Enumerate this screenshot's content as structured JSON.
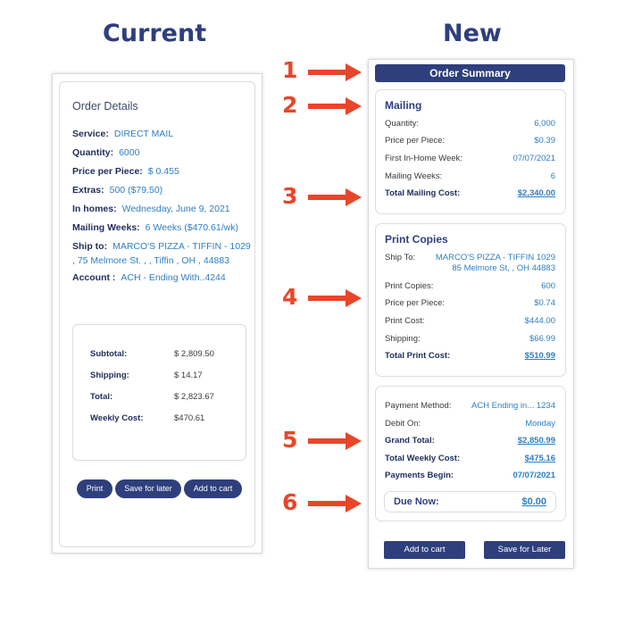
{
  "headings": {
    "current": "Current",
    "new": "New"
  },
  "current": {
    "title": "Order Details",
    "fields": [
      {
        "label": "Service:",
        "value": "DIRECT MAIL"
      },
      {
        "label": "Quantity:",
        "value": "6000"
      },
      {
        "label": "Price per Piece:",
        "value": "$ 0.455"
      },
      {
        "label": "Extras:",
        "value": "500 ($79.50)"
      },
      {
        "label": "In homes:",
        "value": "Wednesday, June 9, 2021"
      },
      {
        "label": "Mailing Weeks:",
        "value": "6 Weeks ($470.61/wk)"
      },
      {
        "label": "Ship to:",
        "value": "MARCO'S PIZZA - TIFFIN - 1029 , 75 Melmore St. , , Tiffin , OH , 44883"
      },
      {
        "label": "Account :",
        "value": "ACH - Ending With..4244"
      }
    ],
    "totals": [
      {
        "label": "Subtotal:",
        "value": "$ 2,809.50"
      },
      {
        "label": "Shipping:",
        "value": "$ 14.17"
      },
      {
        "label": "Total:",
        "value": "$ 2,823.67"
      },
      {
        "label": "Weekly Cost:",
        "value": "$470.61"
      }
    ],
    "buttons": {
      "print": "Print",
      "save": "Save for later",
      "cart": "Add to cart"
    }
  },
  "markers": [
    "1",
    "2",
    "3",
    "4",
    "5",
    "6"
  ],
  "new": {
    "order_summary": "Order Summary",
    "mailing": {
      "title": "Mailing",
      "rows": [
        {
          "label": "Quantity:",
          "value": "6,000"
        },
        {
          "label": "Price per Piece:",
          "value": "$0.39"
        },
        {
          "label": "First In-Home Week:",
          "value": "07/07/2021"
        },
        {
          "label": "Mailing Weeks:",
          "value": "6"
        }
      ],
      "total": {
        "label": "Total Mailing Cost:",
        "value": "$2,340.00"
      }
    },
    "print": {
      "title": "Print Copies",
      "ship_to_label": "Ship To:",
      "ship_to_line1": "MARCO'S PIZZA - TIFFIN 1029",
      "ship_to_line2": "85 Melmore St, , OH 44883",
      "rows": [
        {
          "label": "Print Copies:",
          "value": "600"
        },
        {
          "label": "Price per Piece:",
          "value": "$0.74"
        },
        {
          "label": "Print Cost:",
          "value": "$444.00"
        },
        {
          "label": "Shipping:",
          "value": "$66.99"
        }
      ],
      "total": {
        "label": "Total Print Cost:",
        "value": "$510.99"
      }
    },
    "payment": {
      "method": {
        "label": "Payment Method:",
        "value": "ACH Ending in... 1234"
      },
      "debit": {
        "label": "Debit On:",
        "value": "Monday"
      },
      "grand_total": {
        "label": "Grand Total:",
        "value": "$2,850.99"
      },
      "weekly": {
        "label": "Total Weekly Cost:",
        "value": "$475.16"
      },
      "begin": {
        "label": "Payments Begin:",
        "value": "07/07/2021"
      },
      "due": {
        "label": "Due Now:",
        "value": "$0.00"
      }
    },
    "buttons": {
      "cart": "Add to cart",
      "save": "Save for Later"
    }
  },
  "colors": {
    "navy": "#2e3f7c",
    "link": "#2f7fc1",
    "marker": "#e8462a"
  }
}
